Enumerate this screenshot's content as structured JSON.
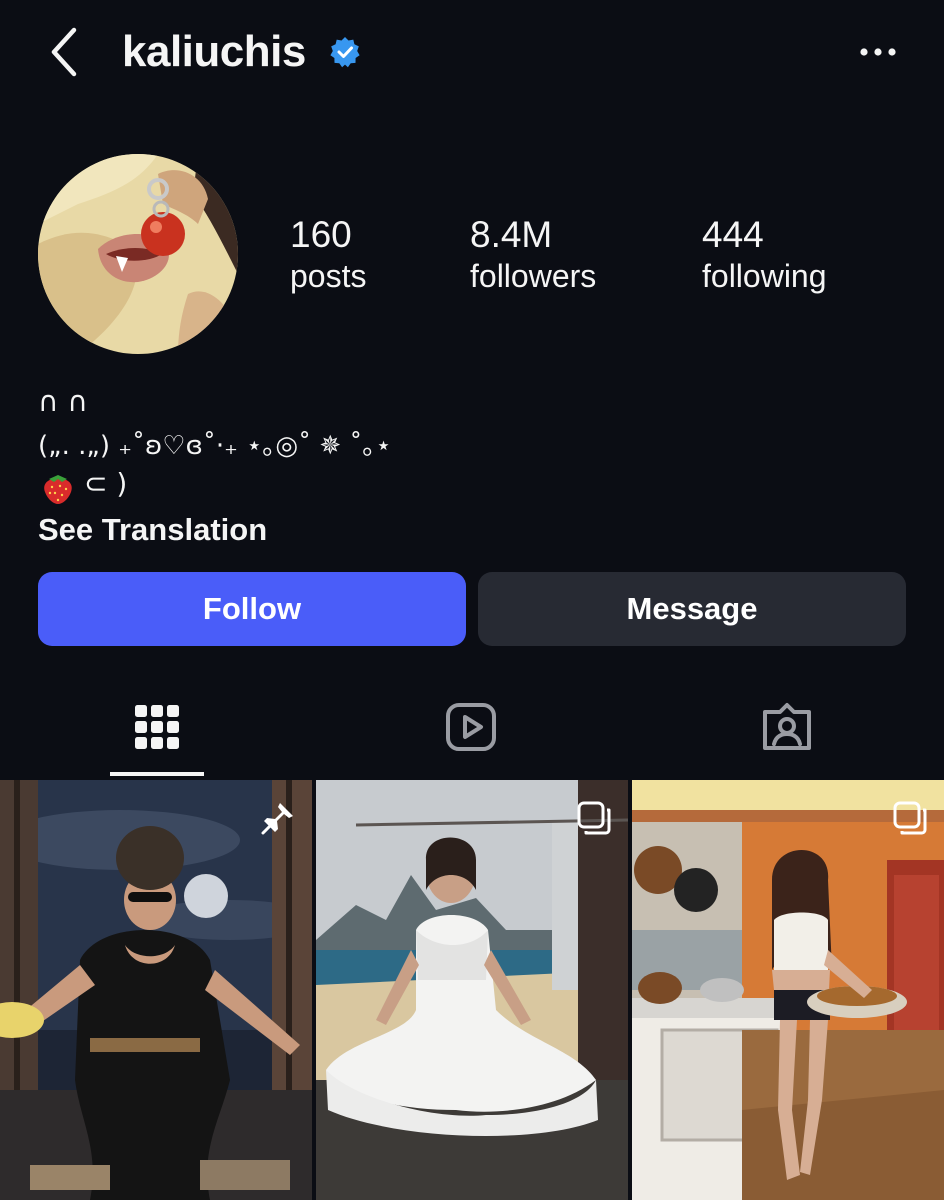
{
  "header": {
    "username": "kaliuchis",
    "verified": true,
    "back_icon": "chevron-left-icon",
    "more_icon": "more-horizontal-icon"
  },
  "profile": {
    "stats": [
      {
        "value": "160",
        "label": "posts"
      },
      {
        "value": "8.4M",
        "label": "followers"
      },
      {
        "value": "444",
        "label": "following"
      }
    ],
    "bio_lines": [
      "∩ ∩",
      "(„. .„) ₊˚ʚ♡ɞ˚⋅₊ ⋆｡◎˚ ✵ ˚｡⋆",
      "⊂ )"
    ],
    "see_translation": "See Translation"
  },
  "actions": {
    "follow": "Follow",
    "message": "Message"
  },
  "tabs": [
    {
      "name": "posts",
      "icon": "grid-icon",
      "active": true
    },
    {
      "name": "reels",
      "icon": "reels-icon",
      "active": false
    },
    {
      "name": "tagged",
      "icon": "tagged-icon",
      "active": false
    }
  ],
  "grid": [
    {
      "badge": "pin-icon"
    },
    {
      "badge": "carousel-icon"
    },
    {
      "badge": "carousel-icon"
    }
  ],
  "colors": {
    "background": "#0b0d14",
    "follow_button": "#4a5df9",
    "message_button": "#272a33",
    "verified_badge": "#3897f0"
  }
}
